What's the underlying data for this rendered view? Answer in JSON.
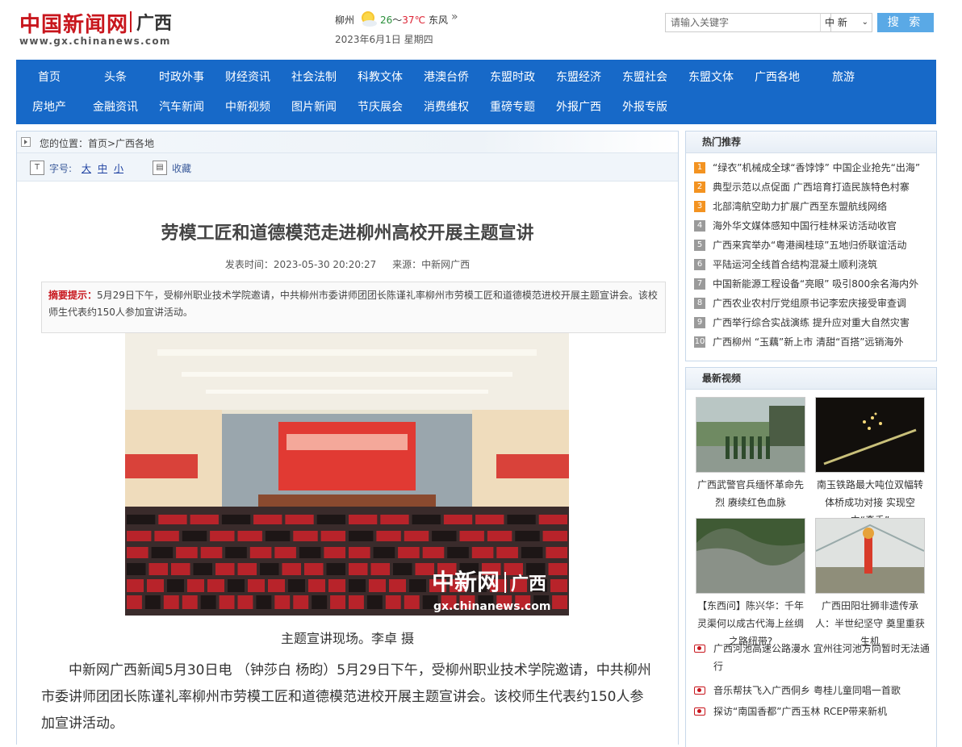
{
  "header": {
    "logo_main": "中国新闻网",
    "logo_region": "广西",
    "logo_url": "www.gx.chinanews.com",
    "weather": {
      "city": "柳州",
      "temp_low": "26",
      "temp_sep": "～",
      "temp_high": "37℃",
      "wind": "东风",
      "more": "»",
      "icon": "sun-cloud-icon"
    },
    "date": "2023年6月1日 星期四",
    "search": {
      "placeholder": "请输入关键字",
      "category": "中 新",
      "button": "搜 索"
    }
  },
  "nav": {
    "row1": [
      "首页",
      "头条",
      "时政外事",
      "财经资讯",
      "社会法制",
      "科教文体",
      "港澳台侨",
      "东盟时政",
      "东盟经济",
      "东盟社会",
      "东盟文体",
      "广西各地",
      "旅游"
    ],
    "row2": [
      "房地产",
      "金融资讯",
      "汽车新闻",
      "中新视频",
      "图片新闻",
      "节庆展会",
      "消费维权",
      "重磅专题",
      "外报广西",
      "外报专版"
    ]
  },
  "article": {
    "breadcrumb": "您的位置：首页>广西各地",
    "font_label": "字号:",
    "font_sizes": [
      "大",
      "中",
      "小"
    ],
    "favorite": "收藏",
    "title": "劳模工匠和道德模范走进柳州高校开展主题宣讲",
    "publish_time": "发表时间：2023-05-30 20:20:27",
    "source": "来源：中新网广西",
    "summary_label": "摘要提示：",
    "summary": "5月29日下午，受柳州职业技术学院邀请，中共柳州市委讲师团团长陈谨礼率柳州市劳模工匠和道德模范进校开展主题宣讲会。该校师生代表约150人参加宣讲活动。",
    "photo_watermark_cn": "中新网",
    "photo_watermark_region": "广西",
    "photo_watermark_url": "gx.chinanews.com",
    "caption": "主题宣讲现场。李卓 摄",
    "body": "中新网广西新闻5月30日电 （钟莎白 杨昀）5月29日下午，受柳州职业技术学院邀请，中共柳州市委讲师团团长陈谨礼率柳州市劳模工匠和道德模范进校开展主题宣讲会。该校师生代表约150人参加宣讲活动。"
  },
  "sidebar": {
    "hot_title": "热门推荐",
    "hot_items": [
      {
        "num": "1",
        "text": "“绿衣”机械成全球“香饽饽” 中国企业抢先“出海”"
      },
      {
        "num": "2",
        "text": "典型示范以点促面 广西培育打造民族特色村寨"
      },
      {
        "num": "3",
        "text": "北部湾航空助力扩展广西至东盟航线网络"
      },
      {
        "num": "4",
        "text": "海外华文媒体感知中国行桂林采访活动收官"
      },
      {
        "num": "5",
        "text": "广西来宾举办“粤港闽桂琼”五地归侨联谊活动"
      },
      {
        "num": "6",
        "text": "平陆运河全线首合结构混凝土顺利浇筑"
      },
      {
        "num": "7",
        "text": "中国新能源工程设备“亮眼” 吸引800余名海内外"
      },
      {
        "num": "8",
        "text": "广西农业农村厅党组原书记李宏庆接受审查调"
      },
      {
        "num": "9",
        "text": "广西举行综合实战演练 提升应对重大自然灾害"
      },
      {
        "num": "10",
        "text": "广西柳州 “玉藕”新上市 清甜“百搭”远销海外"
      }
    ],
    "video_title": "最新视频",
    "videos": [
      {
        "caption": "广西武警官兵缅怀革命先烈 赓续红色血脉"
      },
      {
        "caption": "南玉铁路最大吨位双幅转体桥成功对接 实现空中“牵手”"
      },
      {
        "caption": "【东西问】陈兴华：千年灵渠何以成古代海上丝绸之路纽带?"
      },
      {
        "caption": "广西田阳壮狮非遗传承人：半世纪坚守 奠里重获生机"
      }
    ],
    "video_links": [
      "广西河池高速公路漫水 宜州往河池方向暂时无法通行",
      "音乐帮扶飞入广西侗乡 粤桂儿童同唱一首歌",
      "探访“南国香都”广西玉林 RCEP带来新机"
    ]
  },
  "colors": {
    "nav_bg": "#1769c8",
    "brand_red": "#c8161d",
    "search_btn": "#5aa9e6",
    "hot_top": "#f39321"
  }
}
